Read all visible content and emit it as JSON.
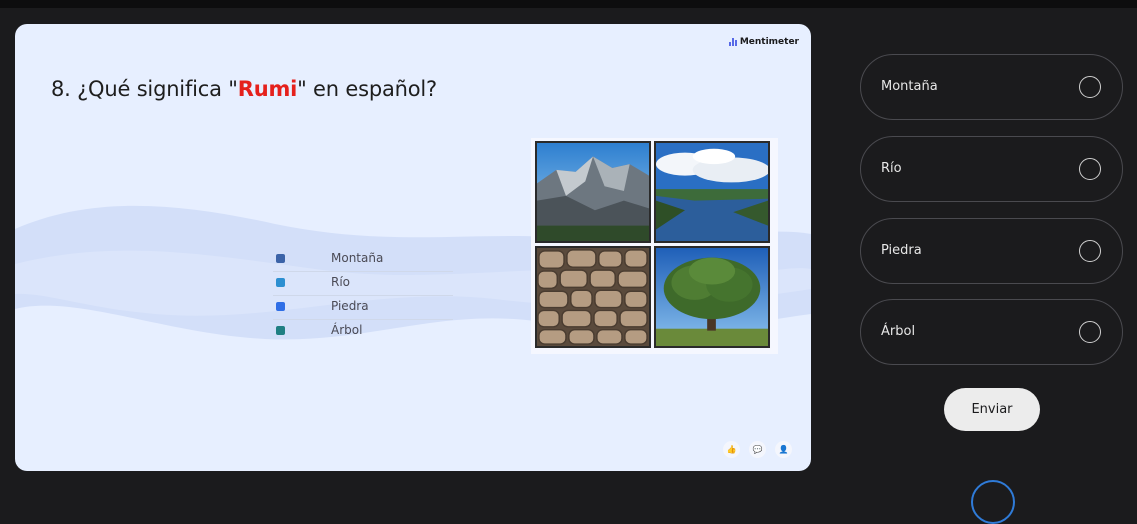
{
  "brand": {
    "name": "Mentimeter"
  },
  "question": {
    "prefix": "8. ¿Qué significa \"",
    "keyword": "Rumi",
    "suffix": "\" en español?"
  },
  "legend": [
    {
      "label": "Montaña",
      "color": "#3b63a8"
    },
    {
      "label": "Río",
      "color": "#2c8fd1"
    },
    {
      "label": "Piedra",
      "color": "#2f6ee6"
    },
    {
      "label": "Árbol",
      "color": "#1f7f83"
    }
  ],
  "images": [
    {
      "icon": "mountain-photo"
    },
    {
      "icon": "river-photo"
    },
    {
      "icon": "stone-wall-photo"
    },
    {
      "icon": "tree-photo"
    }
  ],
  "reactions": [
    {
      "icon": "thumbs-up-icon",
      "glyph": "👍"
    },
    {
      "icon": "comment-icon",
      "glyph": "💬"
    },
    {
      "icon": "person-icon",
      "glyph": "👤"
    }
  ],
  "options": [
    {
      "label": "Montaña"
    },
    {
      "label": "Río"
    },
    {
      "label": "Piedra"
    },
    {
      "label": "Árbol"
    }
  ],
  "submit": {
    "label": "Enviar"
  },
  "colors": {
    "accent_keyword": "#e5201c",
    "slide_background": "#e7efff",
    "panel_background": "#1b1b1d"
  }
}
